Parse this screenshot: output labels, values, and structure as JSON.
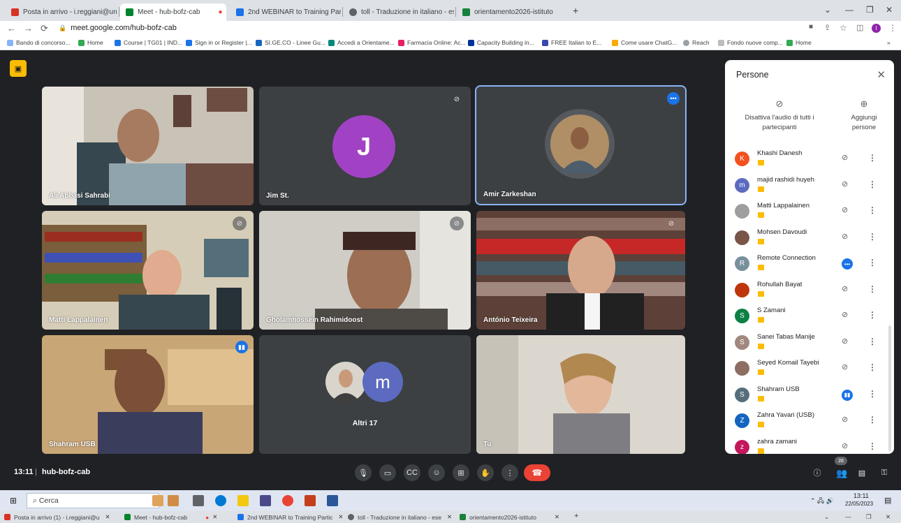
{
  "browser": {
    "tabs": [
      {
        "title": "Posta in arrivo - i.reggiani@unim",
        "color": "#d93025"
      },
      {
        "title": "Meet - hub-bofz-cab",
        "color": "#00832d"
      },
      {
        "title": "2nd WEBINAR to Training Partic",
        "color": "#1a73e8"
      },
      {
        "title": "toll - Traduzione in italiano - ese",
        "color": "#5f6368"
      },
      {
        "title": "orientamento2026-istituto",
        "color": "#188038"
      }
    ],
    "url": "meet.google.com/hub-bofz-cab",
    "bookmarks": [
      "Bando di concorso...",
      "Home",
      "Course | TG01 | IND...",
      "Sign in or Register |...",
      "SI.GE.CO - Linee Gu...",
      "Accedi a Orientame...",
      "Farmacia Online: Ac...",
      "Capacity Building in...",
      "FREE Italian to E...",
      "Come usare ChatG...",
      "Reach",
      "Fondo nuove comp...",
      "Home"
    ]
  },
  "meeting": {
    "time": "13:11",
    "code": "hub-bofz-cab",
    "participant_count": "26",
    "tiles": [
      {
        "name": "Ali Abbasi Sahrabi",
        "kind": "video",
        "bg": "#8a7d6e"
      },
      {
        "name": "Jim St.",
        "kind": "avatar",
        "initial": "J",
        "avatar_color": "#a142c4"
      },
      {
        "name": "Amir Zarkeshan",
        "kind": "photo"
      },
      {
        "name": "Matti Lappalainen",
        "kind": "video",
        "bg": "#7c6b55"
      },
      {
        "name": "Gholamhossein Rahimidoost",
        "kind": "video",
        "bg": "#b7b3a8"
      },
      {
        "name": "António Teixeira",
        "kind": "video",
        "bg": "#6b4a33"
      },
      {
        "name": "Shahram USB",
        "kind": "video",
        "bg": "#9c7a4f"
      },
      {
        "name": "Altri 17",
        "kind": "others",
        "initial": "m",
        "avatar_color": "#5c6bc0"
      },
      {
        "name": "Tu",
        "kind": "video",
        "bg": "#d8d2c8"
      }
    ]
  },
  "panel": {
    "title": "Persone",
    "mute_all": "Disattiva l'audio di tutti i partecipanti",
    "add_people": "Aggiungi persone",
    "people": [
      {
        "name": "Khashi Danesh",
        "initial": "K",
        "color": "#f4511e",
        "state": "muted"
      },
      {
        "name": "majid rashidi huyeh",
        "initial": "m",
        "color": "#5c6bc0",
        "state": "muted"
      },
      {
        "name": "Matti Lappalainen",
        "initial": "",
        "color": "#9e9e9e",
        "state": "muted"
      },
      {
        "name": "Mohsen Davoudi",
        "initial": "",
        "color": "#795548",
        "state": "muted"
      },
      {
        "name": "Remote Connection",
        "initial": "R",
        "color": "#78909c",
        "state": "more"
      },
      {
        "name": "Rohullah Bayat",
        "initial": "",
        "color": "#bf360c",
        "state": "muted"
      },
      {
        "name": "S Zamani",
        "initial": "S",
        "color": "#0b8043",
        "state": "muted"
      },
      {
        "name": "Sanei Tabas Manije",
        "initial": "S",
        "color": "#a1887f",
        "state": "muted"
      },
      {
        "name": "Seyed Komail Tayebi",
        "initial": "",
        "color": "#8d6e63",
        "state": "muted"
      },
      {
        "name": "Shahram USB",
        "initial": "S",
        "color": "#546e7a",
        "state": "speaking"
      },
      {
        "name": "Zahra Yavari (USB)",
        "initial": "Z",
        "color": "#1565c0",
        "state": "muted"
      },
      {
        "name": "zahra zamani",
        "initial": "z",
        "color": "#c2185b",
        "state": "muted"
      }
    ]
  },
  "taskbar": {
    "search_placeholder": "Cerca",
    "time": "13:11",
    "date": "22/05/2023"
  },
  "bottom_tabs": [
    "Posta in arrivo (1) - i.reggiani@u",
    "Meet - hub-bofz-cab",
    "2nd WEBINAR to Training Partic",
    "toll - Traduzione in italiano - ese",
    "orientamento2026-istituto"
  ]
}
